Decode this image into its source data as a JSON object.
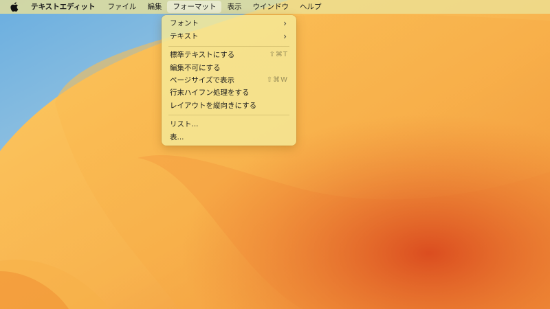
{
  "menubar": {
    "apple_icon": "apple-logo",
    "app_name": "テキストエディット",
    "items": [
      "ファイル",
      "編集",
      "フォーマット",
      "表示",
      "ウインドウ",
      "ヘルプ"
    ],
    "active_item": "フォーマット"
  },
  "format_menu": {
    "font": "フォント",
    "text": "テキスト",
    "make_plain_text": "標準テキストにする",
    "make_plain_text_shortcut": "⇧⌘T",
    "make_read_only": "編集不可にする",
    "wrap_to_page": "ページサイズで表示",
    "wrap_to_page_shortcut": "⇧⌘W",
    "allow_hyphenation": "行末ハイフン処理をする",
    "vertical_layout": "レイアウトを縦向きにする",
    "list": "リスト...",
    "table": "表..."
  }
}
